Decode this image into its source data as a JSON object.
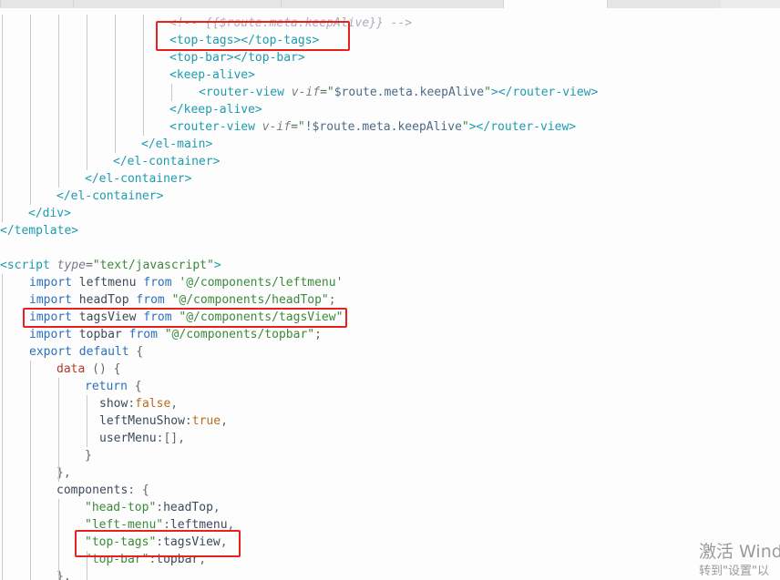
{
  "tabs": [
    {
      "label": ""
    },
    {
      "label": ""
    },
    {
      "label": ""
    },
    {
      "label": ""
    },
    {
      "label": ""
    }
  ],
  "code_lines": [
    {
      "segments": [
        {
          "t": "<!-- {{$route.meta.keepAlive}} -->",
          "c": "comment"
        }
      ]
    },
    {
      "segments": [
        {
          "t": "<top-tags>",
          "c": "tag"
        },
        {
          "t": "</top-tags>",
          "c": "tag"
        }
      ]
    },
    {
      "segments": [
        {
          "t": "<top-bar>",
          "c": "tag"
        },
        {
          "t": "</top-bar>",
          "c": "tag"
        }
      ]
    },
    {
      "segments": [
        {
          "t": "<keep-alive>",
          "c": "tag"
        }
      ]
    },
    {
      "segments": [
        {
          "t": "<router-view ",
          "c": "tag"
        },
        {
          "t": "v-if",
          "c": "attr"
        },
        {
          "t": "=",
          "c": "punct"
        },
        {
          "t": "\"",
          "c": "str"
        },
        {
          "t": "$route.meta.keepAlive",
          "c": "val"
        },
        {
          "t": "\"",
          "c": "str"
        },
        {
          "t": "></router-view>",
          "c": "tag"
        }
      ]
    },
    {
      "segments": [
        {
          "t": "</keep-alive>",
          "c": "tag"
        }
      ]
    },
    {
      "segments": [
        {
          "t": "<router-view ",
          "c": "tag"
        },
        {
          "t": "v-if",
          "c": "attr"
        },
        {
          "t": "=",
          "c": "punct"
        },
        {
          "t": "\"",
          "c": "str"
        },
        {
          "t": "!$route.meta.keepAlive",
          "c": "val"
        },
        {
          "t": "\"",
          "c": "str"
        },
        {
          "t": "></router-view>",
          "c": "tag"
        }
      ]
    },
    {
      "segments": [
        {
          "t": "</el-main>",
          "c": "tag"
        }
      ]
    },
    {
      "segments": [
        {
          "t": "</el-container>",
          "c": "tag"
        }
      ]
    },
    {
      "segments": [
        {
          "t": "</el-container>",
          "c": "tag"
        }
      ]
    },
    {
      "segments": [
        {
          "t": "</el-container>",
          "c": "tag"
        }
      ]
    },
    {
      "segments": [
        {
          "t": "</div>",
          "c": "tag"
        }
      ]
    },
    {
      "segments": [
        {
          "t": "</template>",
          "c": "tag"
        }
      ]
    },
    {
      "segments": []
    },
    {
      "segments": [
        {
          "t": "<script ",
          "c": "tag"
        },
        {
          "t": "type",
          "c": "attr"
        },
        {
          "t": "=",
          "c": "punct"
        },
        {
          "t": "\"text/javascript\"",
          "c": "str"
        },
        {
          "t": ">",
          "c": "tag"
        }
      ]
    },
    {
      "segments": [
        {
          "t": "import ",
          "c": "kw"
        },
        {
          "t": "leftmenu ",
          "c": "plain"
        },
        {
          "t": "from ",
          "c": "kw"
        },
        {
          "t": "'@/components/leftmenu'",
          "c": "str"
        }
      ]
    },
    {
      "segments": [
        {
          "t": "import ",
          "c": "kw"
        },
        {
          "t": "headTop ",
          "c": "plain"
        },
        {
          "t": "from ",
          "c": "kw"
        },
        {
          "t": "\"@/components/headTop\"",
          "c": "str"
        },
        {
          "t": ";",
          "c": "punct"
        }
      ]
    },
    {
      "segments": [
        {
          "t": "import ",
          "c": "kw"
        },
        {
          "t": "tagsView ",
          "c": "plain"
        },
        {
          "t": "from ",
          "c": "kw"
        },
        {
          "t": "\"@/components/tagsView\"",
          "c": "str"
        },
        {
          "t": ";",
          "c": "punct"
        }
      ]
    },
    {
      "segments": [
        {
          "t": "import ",
          "c": "kw"
        },
        {
          "t": "topbar ",
          "c": "plain"
        },
        {
          "t": "from ",
          "c": "kw"
        },
        {
          "t": "\"@/components/topbar\"",
          "c": "str"
        },
        {
          "t": ";",
          "c": "punct"
        }
      ]
    },
    {
      "segments": [
        {
          "t": "export ",
          "c": "kw"
        },
        {
          "t": "default ",
          "c": "kw"
        },
        {
          "t": "{",
          "c": "punct"
        }
      ]
    },
    {
      "segments": [
        {
          "t": "data ",
          "c": "fn"
        },
        {
          "t": "() {",
          "c": "punct"
        }
      ]
    },
    {
      "segments": [
        {
          "t": "return ",
          "c": "kw"
        },
        {
          "t": "{",
          "c": "punct"
        }
      ]
    },
    {
      "segments": [
        {
          "t": "show",
          "c": "plain"
        },
        {
          "t": ":",
          "c": "punct"
        },
        {
          "t": "false",
          "c": "bool"
        },
        {
          "t": ",",
          "c": "punct"
        }
      ]
    },
    {
      "segments": [
        {
          "t": "leftMenuShow",
          "c": "plain"
        },
        {
          "t": ":",
          "c": "punct"
        },
        {
          "t": "true",
          "c": "bool"
        },
        {
          "t": ",",
          "c": "punct"
        }
      ]
    },
    {
      "segments": [
        {
          "t": "userMenu",
          "c": "plain"
        },
        {
          "t": ":[],",
          "c": "punct"
        }
      ]
    },
    {
      "segments": [
        {
          "t": "}",
          "c": "punct"
        }
      ]
    },
    {
      "segments": [
        {
          "t": "},",
          "c": "punct"
        }
      ]
    },
    {
      "segments": [
        {
          "t": "components",
          "c": "plain"
        },
        {
          "t": ": {",
          "c": "punct"
        }
      ]
    },
    {
      "segments": [
        {
          "t": "\"head-top\"",
          "c": "str"
        },
        {
          "t": ":",
          "c": "punct"
        },
        {
          "t": "headTop",
          "c": "plain"
        },
        {
          "t": ",",
          "c": "punct"
        }
      ]
    },
    {
      "segments": [
        {
          "t": "\"left-menu\"",
          "c": "str"
        },
        {
          "t": ":",
          "c": "punct"
        },
        {
          "t": "leftmenu",
          "c": "plain"
        },
        {
          "t": ",",
          "c": "punct"
        }
      ]
    },
    {
      "segments": [
        {
          "t": "\"top-tags\"",
          "c": "str"
        },
        {
          "t": ":",
          "c": "punct"
        },
        {
          "t": "tagsView",
          "c": "plain"
        },
        {
          "t": ",",
          "c": "punct"
        }
      ]
    },
    {
      "segments": [
        {
          "t": "\"top-bar\"",
          "c": "str"
        },
        {
          "t": ":",
          "c": "punct"
        },
        {
          "t": "topbar",
          "c": "plain"
        },
        {
          "t": ",",
          "c": "punct"
        }
      ]
    },
    {
      "segments": [
        {
          "t": "},",
          "c": "punct"
        }
      ]
    }
  ],
  "watermark": {
    "title": "激活 Wind",
    "subtitle": "转到\"设置\"以"
  },
  "colors": {
    "tag": "#1d9bb0",
    "keyword": "#2b6fc0",
    "string": "#3a8a3a",
    "highlight_box": "#e8211f",
    "background": "#fdfdfd"
  }
}
